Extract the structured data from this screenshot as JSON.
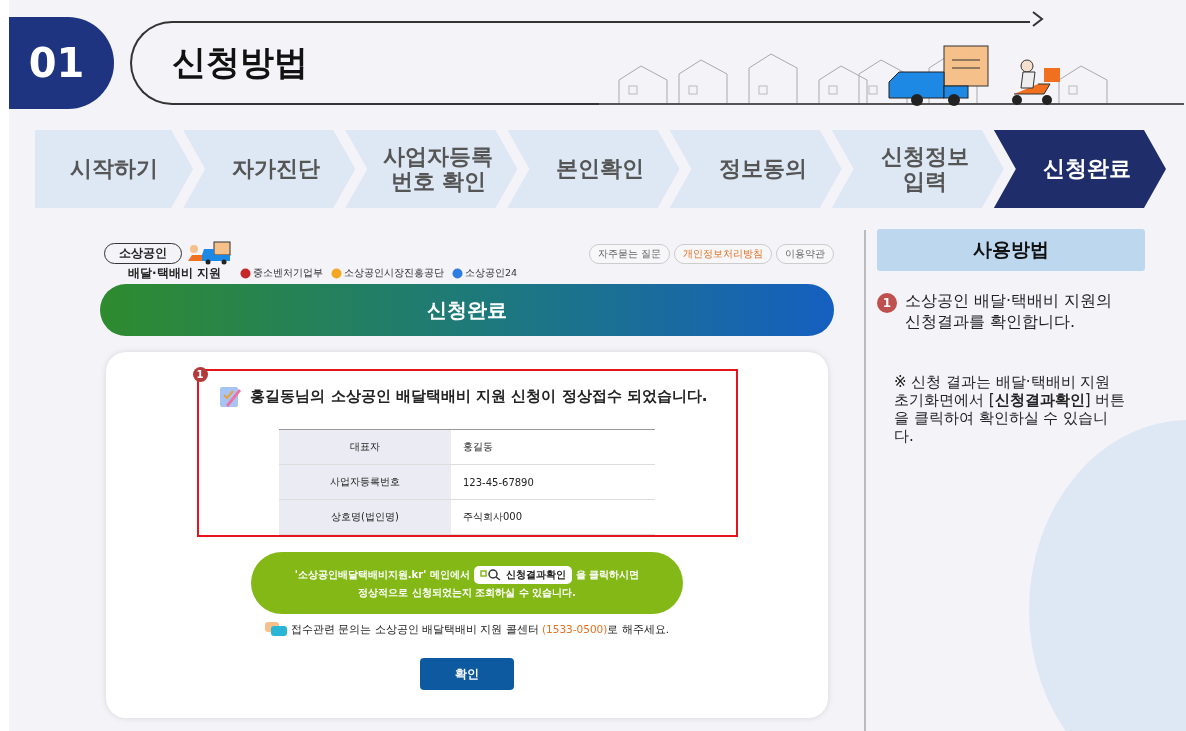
{
  "header": {
    "number": "01",
    "title": "신청방법"
  },
  "steps": [
    {
      "lines": [
        "시작하기"
      ],
      "selected": false
    },
    {
      "lines": [
        "자가진단"
      ],
      "selected": false
    },
    {
      "lines": [
        "사업자등록",
        "번호 확인"
      ],
      "selected": false
    },
    {
      "lines": [
        "본인확인"
      ],
      "selected": false
    },
    {
      "lines": [
        "정보동의"
      ],
      "selected": false
    },
    {
      "lines": [
        "신청정보",
        "입력"
      ],
      "selected": false
    },
    {
      "lines": [
        "신청완료"
      ],
      "selected": true
    }
  ],
  "screen": {
    "logo": {
      "top": "소상공인",
      "bottom": "배달·택배비 지원"
    },
    "agencies": [
      "중소벤처기업부",
      "소상공인시장진흥공단",
      "소상공인24"
    ],
    "top_links": [
      {
        "label": "자주묻는 질문",
        "kind": "normal"
      },
      {
        "label": "개인정보처리방침",
        "kind": "highlight"
      },
      {
        "label": "이용약관",
        "kind": "normal"
      }
    ],
    "banner": "신청완료",
    "marker": "1",
    "message": "홍길동님의 소상공인 배달택배비 지원 신청이 정상접수 되었습니다.",
    "table": [
      {
        "label": "대표자",
        "value": "홍길동"
      },
      {
        "label": "사업자등록번호",
        "value": "123-45-67890"
      },
      {
        "label": "상호명(법인명)",
        "value": "주식회사000"
      }
    ],
    "notice": {
      "before": "'소상공인배달택배비지원.kr' 메인에서",
      "button": "신청결과확인",
      "after": "을 클릭하시면",
      "line2": "정상적으로 신청되었는지 조회하실 수 있습니다."
    },
    "contact": {
      "text": "접수관련 문의는 소상공인 배달택배비 지원 콜센터 ",
      "phone": "(1533-0500)",
      "after": "로 해주세요."
    },
    "confirm": "확인"
  },
  "sidebar": {
    "title": "사용방법",
    "items": [
      {
        "number": "1",
        "text": "소상공인 배달·택배비 지원의 신청결과를 확인합니다."
      }
    ],
    "note": "※ 신청 결과는 배달·택배비 지원 초기화면에서 [**신청결과확인**] 버튼을 클릭하여 확인하실 수 있습니다."
  }
}
